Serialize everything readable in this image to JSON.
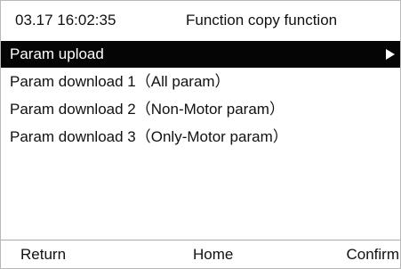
{
  "header": {
    "datetime": "03.17 16:02:35",
    "title": "Function copy function"
  },
  "menu": {
    "items": [
      {
        "label": "Param upload",
        "selected": true,
        "icon": "arrow-right-icon"
      },
      {
        "label": "Param download 1（All param）"
      },
      {
        "label": "Param download 2（Non-Motor param）"
      },
      {
        "label": "Param download 3（Only-Motor param）"
      }
    ]
  },
  "footer": {
    "return_label": "Return",
    "home_label": "Home",
    "confirm_label": "Confirm"
  },
  "colors": {
    "selection_background": "#050505",
    "selection_text": "#ffffff",
    "text": "#111111",
    "background": "#ffffff",
    "border": "#b8b8b8"
  }
}
